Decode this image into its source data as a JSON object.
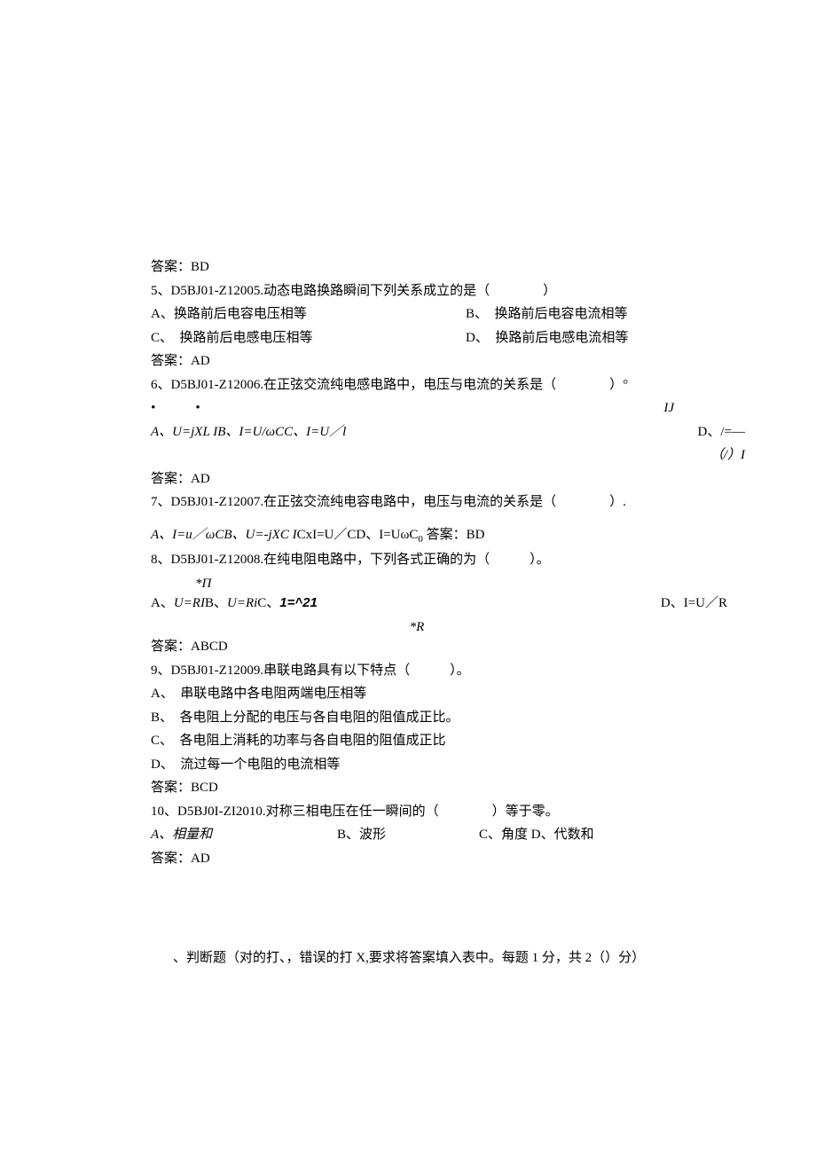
{
  "ans4": "答案：BD",
  "q5": {
    "stem": "5、D5BJ01-Z12005.动态电路换路瞬间下列关系成立的是（　　　　）",
    "a": "A、换路前后电容电压相等",
    "b": "B、　换路前后电容电流相等",
    "c": "C、　换路前后电感电压相等",
    "d": "D、　换路前后电感电流相等",
    "ans": "答案：AD"
  },
  "q6": {
    "stem": "6、D5BJ01-Z12006.在正弦交流纯电感电路中，电压与电流的关系是（　　　　）°",
    "dot": "•　　　•",
    "ij": "IJ",
    "abc": "A、U=jXL IB、I=U/ωCC、I=U／l",
    "d": "D、/=—",
    "frac": "（/）I",
    "ans": "答案：AD"
  },
  "q7": {
    "stem": "7、D5BJ01-Z12007.在正弦交流纯电容电路中，电压与电流的关系是（　　　　）.",
    "opts_prefix": "A、I=u／ωCB、",
    "opts_mid": "U=-jXC I",
    "opts_suffix": "CxI=U／CD、I=UωC",
    "opts_zero": "0",
    "ans_inline": "答案：BD"
  },
  "q8": {
    "stem": "8、D5BJ01-Z12008.在纯电阻电路中，下列各式正确的为（　　　）。",
    "sup": "*П",
    "abc_a": "A、",
    "abc_aeq": "U=RI",
    "abc_b": "B、",
    "abc_beq": "U=Ri",
    "abc_c": "C、",
    "abc_ceq": "1=^21",
    "d": "D、I=U／R",
    "sub": "*R",
    "ans": "答案：ABCD"
  },
  "q9": {
    "stem": "9、D5BJ01-Z12009.串联电路具有以下特点（　　　）。",
    "a": "A、　串联电路中各电阻两端电压相等",
    "b": "B、　各电阻上分配的电压与各自电阻的阻值成正比。",
    "c": "C、　各电阻上消耗的功率与各自电阻的阻值成正比",
    "d": "D、　流过每一个电阻的电流相等",
    "ans": "答案：BCD"
  },
  "q10": {
    "stem": "10、D5BJ0I-ZI2010.对称三相电压在任一瞬间的（　　　　）等于零。",
    "a": "A、相量和",
    "b": "B、波形",
    "cd": "C、角度 D、代数和",
    "ans": "答案：AD"
  },
  "footer": "、判断题（对的打、，错误的打 X,要求将答案填入表中。每题 1 分，共 2（）分）"
}
